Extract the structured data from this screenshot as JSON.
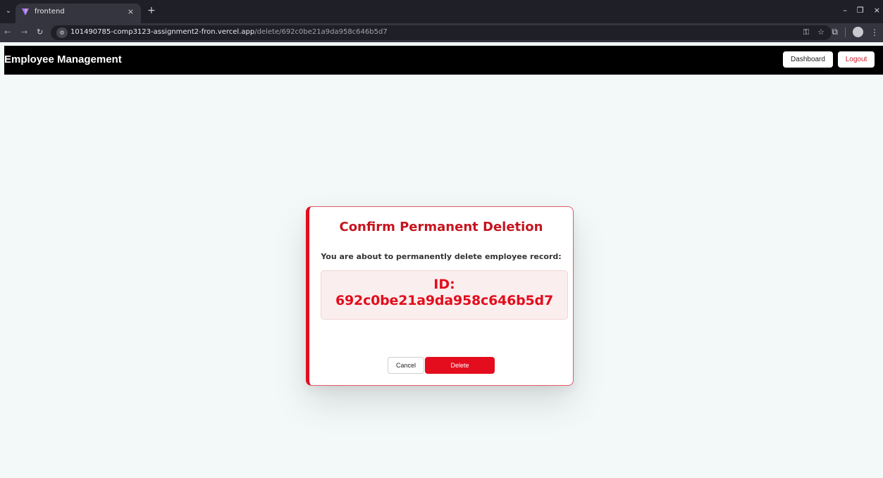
{
  "browser": {
    "tab_title": "frontend",
    "url_host": "101490785-comp3123-assignment2-fron.vercel.app",
    "url_path": "/delete/692c0be21a9da958c646b5d7",
    "icons": [
      "chevron-down-icon",
      "close-icon",
      "plus-icon",
      "back-icon",
      "forward-icon",
      "reload-icon",
      "site-info-icon",
      "key-icon",
      "star-icon",
      "extensions-icon",
      "profile-icon",
      "menu-icon",
      "minimize-icon",
      "restore-icon"
    ]
  },
  "header": {
    "brand": "Employee Management",
    "dashboard_label": "Dashboard",
    "logout_label": "Logout"
  },
  "modal": {
    "title": "Confirm Permanent Deletion",
    "message": "You are about to permanently delete employee record:",
    "id_label": "ID:",
    "id_value": "692c0be21a9da958c646b5d7",
    "cancel_label": "Cancel",
    "delete_label": "Delete"
  },
  "colors": {
    "accent": "#e30d1d",
    "header_bg": "#000000",
    "page_bg": "#f3f8f8"
  }
}
